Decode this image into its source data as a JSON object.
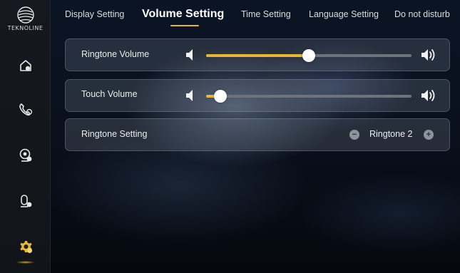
{
  "brand": {
    "name": "TEKNOLINE"
  },
  "tabs": [
    {
      "label": "Display Setting"
    },
    {
      "label": "Volume Setting",
      "active": true
    },
    {
      "label": "Time Setting"
    },
    {
      "label": "Language Setting"
    },
    {
      "label": "Do not disturb"
    }
  ],
  "sidebar": {
    "items": [
      {
        "icon": "home-icon"
      },
      {
        "icon": "phone-icon"
      },
      {
        "icon": "camera-icon"
      },
      {
        "icon": "intercom-icon"
      },
      {
        "icon": "settings-icon",
        "active": true
      }
    ]
  },
  "settings": {
    "ringtone_volume": {
      "label": "Ringtone Volume",
      "level_fraction": 0.5
    },
    "touch_volume": {
      "label": "Touch Volume",
      "level_fraction": 0.07
    },
    "ringtone_setting": {
      "label": "Ringtone Setting",
      "minus": "−",
      "value": "Ringtone 2",
      "plus": "+"
    }
  },
  "colors": {
    "accent": "#e8b535",
    "track": "#6e737b",
    "sidebar_bg": "#15191f"
  }
}
